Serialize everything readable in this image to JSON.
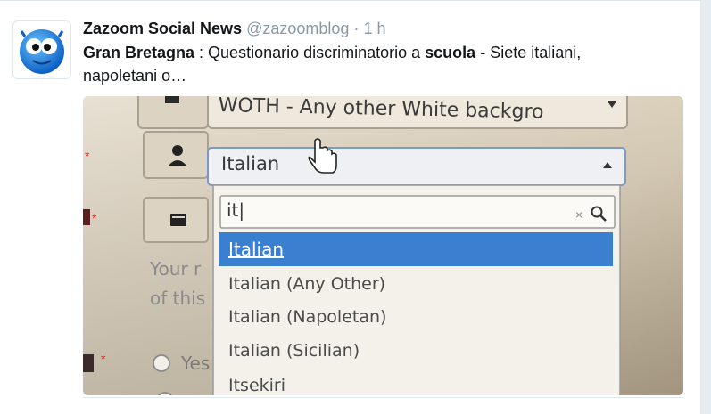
{
  "tweet": {
    "author_name": "Zazoom Social News",
    "author_handle": "@zazoomblog",
    "separator": "·",
    "timestamp": "1 h",
    "text_bold_1": "Gran Bretagna",
    "text_part_1": " : Questionario discriminatorio a ",
    "text_bold_2": "scuola",
    "text_part_2": " - Siete italiani, napoletani o…"
  },
  "photo": {
    "top_select_value": "WOTH - Any other White backgro",
    "select_value": "Italian",
    "search_value": "it|",
    "options": [
      "Italian",
      "Italian (Any Other)",
      "Italian (Napoletan)",
      "Italian (Sicilian)",
      "Itsekiri"
    ],
    "selected_option_index": 0,
    "side_text_line_1": "Your r",
    "side_text_line_2": "of this",
    "radio_label": "Yes",
    "highlight_color": "#3b7fd1"
  },
  "colors": {
    "name": "#14171a",
    "handle": "#8899a6",
    "avatar_blue": "#1e88e5"
  },
  "icons": [
    "avatar-logo-icon",
    "person-icon",
    "book-icon",
    "search-icon",
    "clear-icon",
    "caret-up-icon",
    "caret-down-icon",
    "hand-cursor-icon",
    "radio-icon"
  ]
}
